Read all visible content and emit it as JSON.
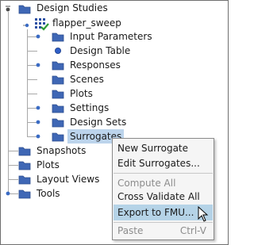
{
  "tree": {
    "root": {
      "label": "Design Studies"
    },
    "study": {
      "label": "flapper_sweep"
    },
    "children": [
      {
        "label": "Input Parameters",
        "icon": "folder-icon"
      },
      {
        "label": "Design Table",
        "icon": "blue-dot-icon"
      },
      {
        "label": "Responses",
        "icon": "folder-icon"
      },
      {
        "label": "Scenes",
        "icon": "folder-icon"
      },
      {
        "label": "Plots",
        "icon": "folder-icon"
      },
      {
        "label": "Settings",
        "icon": "folder-icon"
      },
      {
        "label": "Design Sets",
        "icon": "folder-icon"
      },
      {
        "label": "Surrogates",
        "icon": "folder-icon",
        "selected": true
      }
    ],
    "top_level": [
      {
        "label": "Snapshots"
      },
      {
        "label": "Plots"
      },
      {
        "label": "Layout Views"
      },
      {
        "label": "Tools"
      }
    ]
  },
  "context_menu": {
    "items": [
      {
        "label": "New Surrogate",
        "enabled": true
      },
      {
        "label": "Edit Surrogates...",
        "enabled": true
      },
      {
        "label": "Compute All",
        "enabled": false
      },
      {
        "label": "Cross Validate All",
        "enabled": true
      },
      {
        "label": "Export to FMU...",
        "enabled": true,
        "hovered": true
      },
      {
        "label": "Paste",
        "shortcut": "Ctrl-V",
        "enabled": false
      }
    ]
  },
  "colors": {
    "folder": "#3f67b5",
    "selection": "#bcd4ec",
    "menu_hover": "#b5d3e7",
    "checkmark": "#2e9b36"
  }
}
